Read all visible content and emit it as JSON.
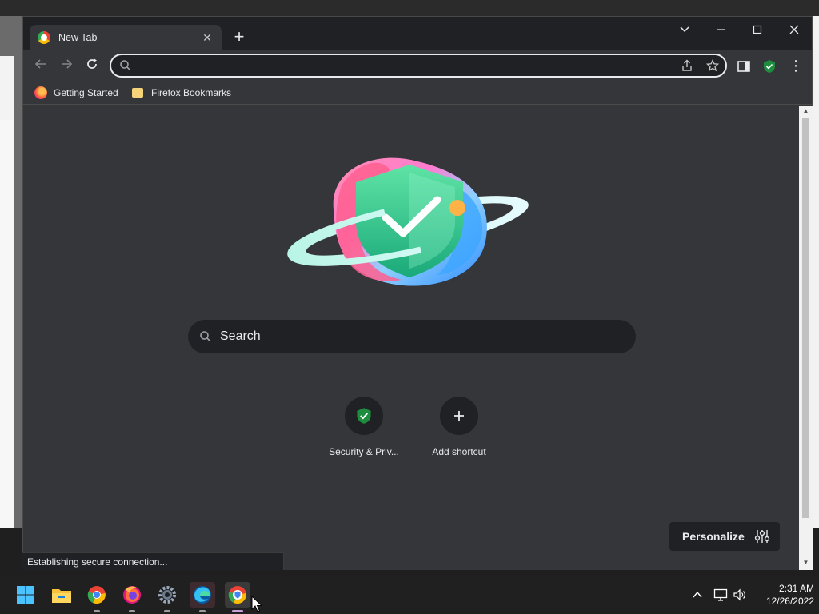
{
  "browser": {
    "tab": {
      "title": "New Tab",
      "close_glyph": "✕"
    },
    "new_tab_glyph": "+",
    "window_controls": {
      "list_tabs": "⌄",
      "minimize": "—",
      "maximize": "☐",
      "close": "✕"
    },
    "toolbar": {
      "back": "←",
      "forward": "→",
      "reload": "↻",
      "address_value": "",
      "menu": "⋮"
    },
    "bookmarks": [
      {
        "label": "Getting Started",
        "icon": "firefox-icon"
      },
      {
        "label": "Firefox Bookmarks",
        "icon": "folder-icon"
      }
    ]
  },
  "ntp": {
    "search_placeholder": "Search",
    "shortcuts": [
      {
        "title": "Security & Priv...",
        "icon": "shield-check-icon"
      },
      {
        "title": "Add shortcut",
        "icon": "plus-icon"
      }
    ],
    "personalize_label": "Personalize"
  },
  "status_text": "Establishing secure connection...",
  "taskbar": {
    "apps": [
      "start-icon",
      "file-explorer-icon",
      "chrome-icon",
      "firefox-icon",
      "settings-icon",
      "edge-icon",
      "chromium-shield-icon"
    ],
    "clock": {
      "time": "2:31 AM",
      "date": "12/26/2022"
    }
  },
  "colors": {
    "accent": "#8ab4f8",
    "frame": "#202124",
    "surface": "#35363a",
    "shield_green": "#1e8e3e"
  }
}
